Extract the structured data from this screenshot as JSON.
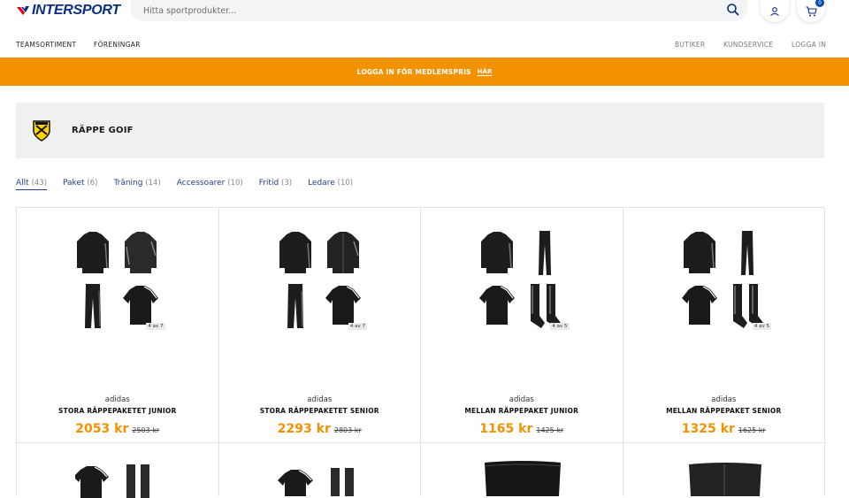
{
  "header": {
    "logo_text": "INTERSPORT",
    "search_placeholder": "Hitta sportprodukter...",
    "cart_count": "0"
  },
  "nav": {
    "left": [
      "TEAMSORTIMENT",
      "FÖRENINGAR"
    ],
    "right": [
      "BUTIKER",
      "KUNDSERVICE",
      "LOGGA IN"
    ]
  },
  "banner": {
    "text": "LOGGA IN FÖR MEDLEMSPRIS",
    "link": "HÄR"
  },
  "club": {
    "name": "RÄPPE GOIF"
  },
  "filters": [
    {
      "label": "Allt",
      "count": "(43)"
    },
    {
      "label": "Paket",
      "count": "(6)"
    },
    {
      "label": "Träning",
      "count": "(14)"
    },
    {
      "label": "Accessoarer",
      "count": "(10)"
    },
    {
      "label": "Fritid",
      "count": "(3)"
    },
    {
      "label": "Ledare",
      "count": "(10)"
    }
  ],
  "products": [
    {
      "brand": "adidas",
      "name": "STORA RÄPPEPAKETET JUNIOR",
      "price": "2053 kr",
      "old_price": "2503 kr",
      "badge": "4 av 7"
    },
    {
      "brand": "adidas",
      "name": "STORA RÄPPEPAKETET SENIOR",
      "price": "2293 kr",
      "old_price": "2803 kr",
      "badge": "4 av 7"
    },
    {
      "brand": "adidas",
      "name": "MELLAN RÄPPEPAKET JUNIOR",
      "price": "1165 kr",
      "old_price": "1425 kr",
      "badge": "4 av 5"
    },
    {
      "brand": "adidas",
      "name": "MELLAN RÄPPEPAKET SENIOR",
      "price": "1325 kr",
      "old_price": "1625 kr",
      "badge": "4 av 5"
    }
  ],
  "colors": {
    "brand_blue": "#0b2d86",
    "brand_red": "#e1001a",
    "accent_orange": "#f39200",
    "link_blue": "#1f3f8f"
  }
}
